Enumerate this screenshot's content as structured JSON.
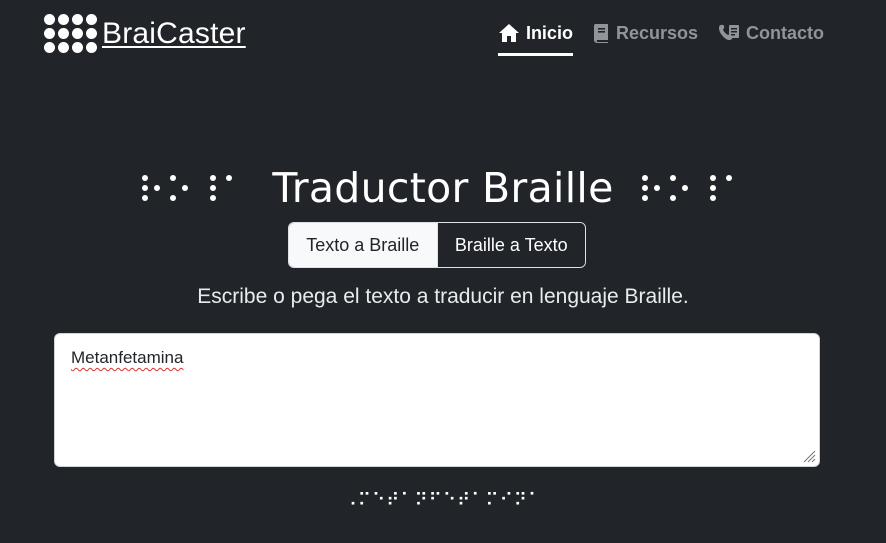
{
  "brand": {
    "name": "BraiCaster",
    "logo_icon": "braille-dots-logo-icon"
  },
  "nav": {
    "items": [
      {
        "label": "Inicio",
        "icon": "home-icon",
        "active": true
      },
      {
        "label": "Recursos",
        "icon": "book-icon",
        "active": false
      },
      {
        "label": "Contacto",
        "icon": "contact-card-icon",
        "active": false
      }
    ]
  },
  "main": {
    "title": "Traductor Braille",
    "title_braille_decoration": "⠗⠁⠊⠁",
    "mode_toggle": {
      "options": [
        "Texto a Braille",
        "Braille a Texto"
      ],
      "selected": "Texto a Braille"
    },
    "instructions": "Escribe o pega el texto a traducir en lenguaje Braille.",
    "input_value": "Metanfetamina",
    "output_braille": "⠠⠍⠑⠞⠁⠝⠋⠑⠞⠁⠍⠊⠝⠁"
  },
  "colors": {
    "background": "#212529",
    "text": "#ffffff",
    "nav_inactive": "#8f959b",
    "input_background": "#ffffff",
    "spellcheck_underline": "#d9302c"
  }
}
